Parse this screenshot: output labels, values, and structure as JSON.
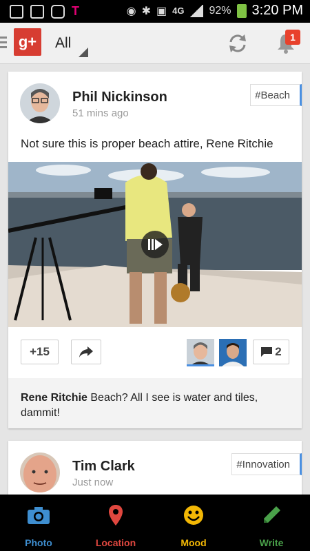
{
  "status_bar": {
    "network": "4G",
    "battery": "92%",
    "time": "3:20 PM"
  },
  "app_bar": {
    "logo_text": "g+",
    "stream": "All",
    "notification_count": "1"
  },
  "posts": [
    {
      "author": "Phil Nickinson",
      "time": "51 mins ago",
      "hashtag": "#Beach",
      "text": "Not sure this is proper beach attire, Rene Ritchie",
      "plus_count": "+15",
      "comment_count": "2",
      "comment": {
        "author": "Rene Ritchie",
        "text": "Beach? All I see is water and tiles, dammit!"
      }
    },
    {
      "author": "Tim Clark",
      "time": "Just now",
      "hashtag": "#Innovation"
    }
  ],
  "actions": [
    {
      "label": "Photo",
      "color": "#3e8ed0",
      "icon": "camera-icon"
    },
    {
      "label": "Location",
      "color": "#e0473f",
      "icon": "location-pin-icon"
    },
    {
      "label": "Mood",
      "color": "#f2b705",
      "icon": "smiley-icon"
    },
    {
      "label": "Write",
      "color": "#4aa14a",
      "icon": "pencil-icon"
    }
  ],
  "colors": {
    "brand_red": "#d73d32",
    "accent_blue": "#4a90e2",
    "badge_red": "#e8412c"
  }
}
